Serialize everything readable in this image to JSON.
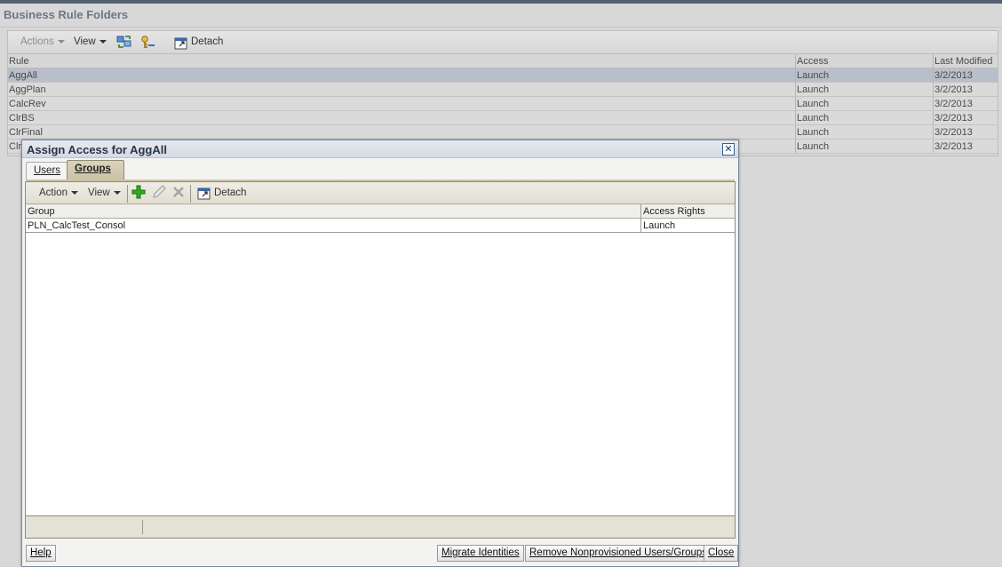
{
  "background": {
    "title": "Business Rule Folders",
    "toolbar": {
      "actions_label": "Actions",
      "view_label": "View",
      "detach_label": "Detach"
    },
    "grid": {
      "columns": [
        "Rule",
        "Access",
        "Last Modified"
      ],
      "rows": [
        {
          "rule": "AggAll",
          "access": "Launch",
          "modified": "3/2/2013",
          "selected": true
        },
        {
          "rule": "AggPlan",
          "access": "Launch",
          "modified": "3/2/2013"
        },
        {
          "rule": "CalcRev",
          "access": "Launch",
          "modified": "3/2/2013"
        },
        {
          "rule": "ClrBS",
          "access": "Launch",
          "modified": "3/2/2013"
        },
        {
          "rule": "ClrFinal",
          "access": "Launch",
          "modified": "3/2/2013"
        },
        {
          "rule": "Clr",
          "access": "Launch",
          "modified": "3/2/2013"
        }
      ]
    }
  },
  "dialog": {
    "title": "Assign Access for AggAll",
    "tabs": [
      {
        "label": "Users",
        "active": false
      },
      {
        "label": "Groups",
        "active": true
      }
    ],
    "toolbar": {
      "action_label": "Action",
      "view_label": "View",
      "detach_label": "Detach"
    },
    "grid": {
      "columns": [
        "Group",
        "Access Rights"
      ],
      "rows": [
        {
          "group": "PLN_CalcTest_Consol",
          "rights": "Launch"
        }
      ]
    },
    "buttons": {
      "help": "Help",
      "migrate": "Migrate Identities",
      "remove": "Remove Nonprovisioned Users/Groups",
      "close": "Close"
    }
  },
  "colors": {
    "dialog_border": "#7b8aa0",
    "selected_row": "#b9bfca",
    "active_tab": "#cbc3a6",
    "add_icon": "#2fae1f"
  },
  "icons": [
    "dropdown-caret-icon",
    "refresh-icon",
    "key-icon",
    "detach-icon",
    "close-icon",
    "add-icon",
    "edit-icon",
    "delete-icon"
  ]
}
